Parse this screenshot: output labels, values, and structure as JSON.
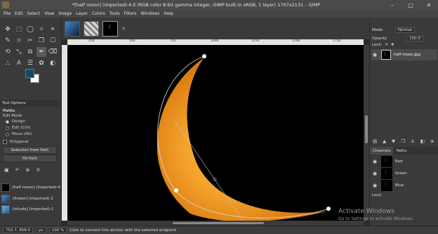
{
  "window": {
    "title": "*[half moon] (imported)-4.0 (RGB color 8-bit gamma integer, GIMP built-in sRGB, 1 layer) 1707x2131 – GIMP",
    "minimize": "–",
    "maximize": "□",
    "close": "✕"
  },
  "menu": [
    "File",
    "Edit",
    "Select",
    "View",
    "Image",
    "Layer",
    "Colors",
    "Tools",
    "Filters",
    "Windows",
    "Help"
  ],
  "tools": [
    "✥",
    "⬚",
    "◯",
    "✧",
    "⌖",
    "✎",
    "⌗",
    "✂",
    "❐",
    "☐",
    "⟲",
    "⤡",
    "⧉",
    "✒",
    "⌫",
    "⛬",
    "A",
    "☰",
    "✿",
    "◐"
  ],
  "tool_options": {
    "tab_label": "Tool Options",
    "section": "Paths",
    "edit_mode_label": "Edit Mode",
    "modes": [
      "Design",
      "Edit (Ctrl)",
      "Move (Alt)"
    ],
    "polygonal": "Polygonal",
    "selection_button": "Selection from Path",
    "fill_button": "Fill Path",
    "icons": [
      "▣",
      "↶",
      "⊗",
      "✕"
    ]
  },
  "images": [
    {
      "name": "[half moon] (imported)-4"
    },
    {
      "name": "[flower] (imported)-2"
    },
    {
      "name": "[intuda] (imported)-1"
    }
  ],
  "ruler": {
    "labels": [
      "250",
      "500",
      "750",
      "1000",
      "1250",
      "1500",
      "1750"
    ]
  },
  "right_panel": {
    "mode_label": "Mode",
    "mode_value": "Normal",
    "opacity_label": "Opacity",
    "opacity_value": "100.0",
    "lock_label": "Lock:",
    "layer_name": "half moon.jpg",
    "tabs": [
      "Channels",
      "Paths"
    ],
    "channels": [
      "Red",
      "Green",
      "Blue"
    ],
    "channel_lock": "Lock:"
  },
  "status": {
    "coords": "752.7, 858.0",
    "unit": "px",
    "zoom": "100 %",
    "message": "Click to connect this anchor with the selected endpoint"
  },
  "watermark": {
    "line1": "Activate Windows",
    "line2": "Go to Settings to activate Windows."
  },
  "colors": {
    "foreground": "#0f4d5f",
    "background": "#ffffff",
    "moon_outer": "#e8840e",
    "moon_inner": "#f6b43a"
  }
}
